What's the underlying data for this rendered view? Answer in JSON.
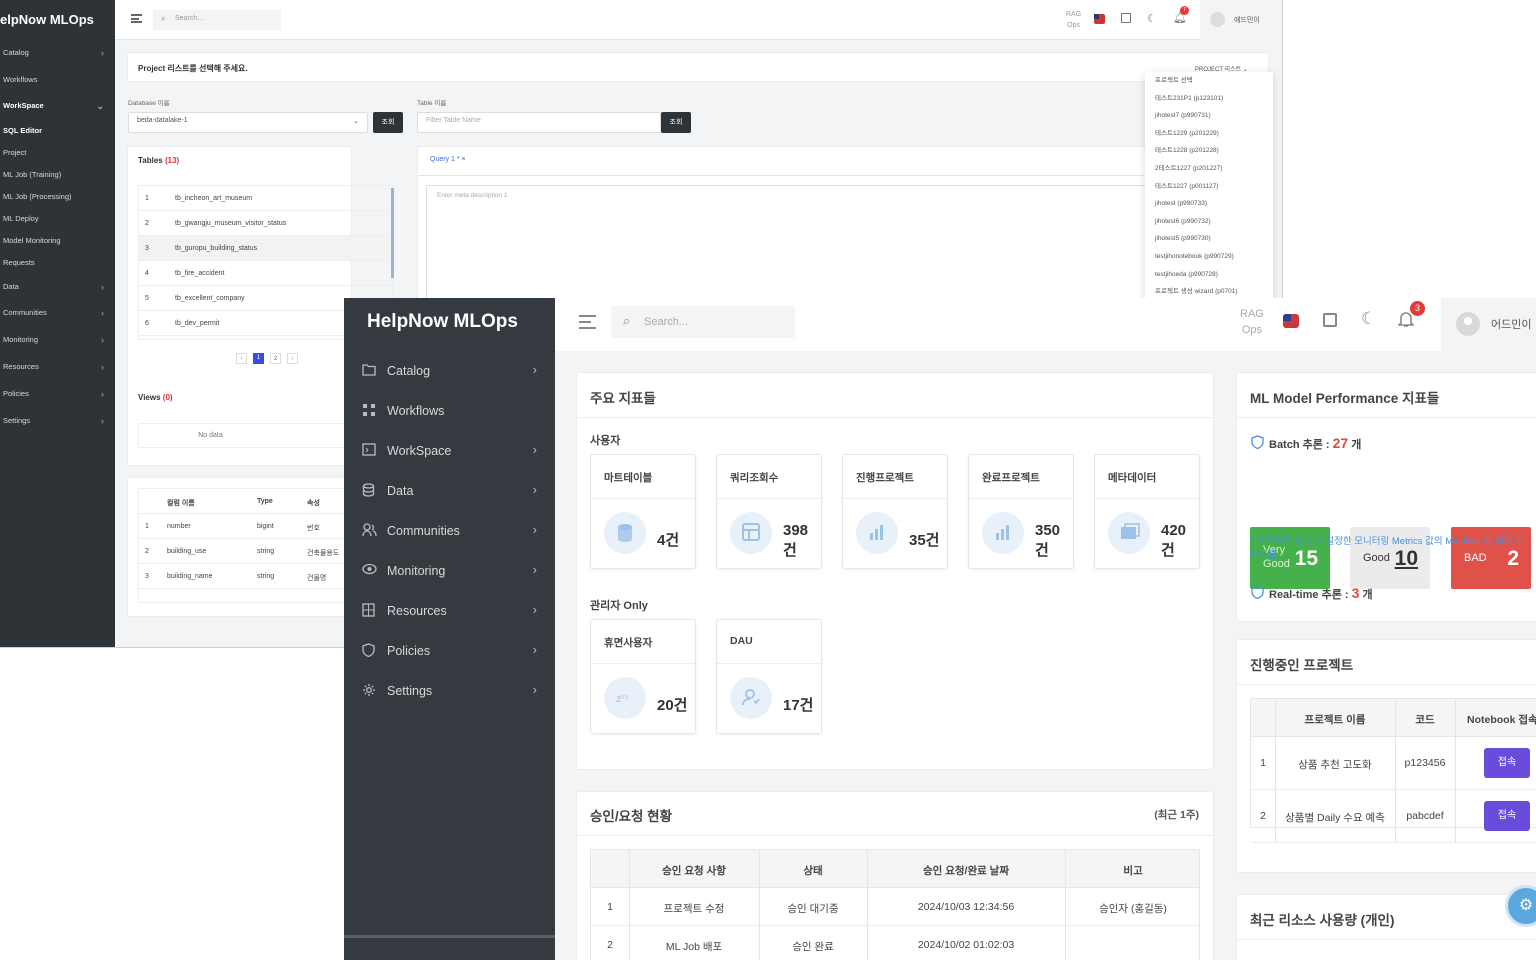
{
  "back": {
    "brand": "elpNow MLOps",
    "sidebar": [
      "Catalog",
      "Workflows",
      "WorkSpace",
      "SQL Editor",
      "Project",
      "ML Job (Training)",
      "ML Job (Processing)",
      "ML Deploy",
      "Model Monitoring",
      "Requests",
      "Data",
      "Communities",
      "Monitoring",
      "Resources",
      "Policies",
      "Settings"
    ],
    "search_placeholder": "Search...",
    "header_rag": "RAG",
    "header_ops": "Ops",
    "user": "에드민이",
    "bell_count": "7",
    "project_prompt": "Project 리스트를 선택해 주세요.",
    "project_dropdown_label": "PROJECT 리스트",
    "database_label": "Database 이름",
    "database_value": "beda-datalake-1",
    "table_label": "Table 이름",
    "table_placeholder": "Filter Table Name",
    "query_button": "조회",
    "tables_title": "Tables",
    "tables_count": "(13)",
    "tables": [
      {
        "no": "1",
        "name": "tb_incheon_art_museum"
      },
      {
        "no": "2",
        "name": "tb_gwangju_museum_visitor_status"
      },
      {
        "no": "3",
        "name": "tb_guropu_building_status"
      },
      {
        "no": "4",
        "name": "tb_fire_accident"
      },
      {
        "no": "5",
        "name": "tb_excellent_company"
      },
      {
        "no": "6",
        "name": "tb_dev_permit"
      }
    ],
    "pages": [
      "1",
      "2"
    ],
    "views_title": "Views",
    "views_count": "(0)",
    "no_data": "No data",
    "query_tab": "Query 1 *",
    "editor_placeholder": "Enter meta description 1",
    "columns_head": [
      "컬럼 이름",
      "Type",
      "속성"
    ],
    "columns": [
      {
        "no": "1",
        "name": "number",
        "type": "bigint",
        "attr": "번호"
      },
      {
        "no": "2",
        "name": "building_use",
        "type": "string",
        "attr": "건축물용도"
      },
      {
        "no": "3",
        "name": "building_name",
        "type": "string",
        "attr": "건물명"
      }
    ],
    "projects": [
      "프로젝트 선택",
      "테스트231P1 (p123101)",
      "jihotest7 (p990731)",
      "테스트1229 (p201229)",
      "테스트1228 (p201228)",
      "2테스트1227 (p201227)",
      "테스트1227 (p001127)",
      "jihotest (p990733)",
      "jihotest6 (p990732)",
      "jihotest5 (p990730)",
      "testjihonotebook (p990729)",
      "testjihoeda (p990728)",
      "프로젝트 생성 wizard (p0701)"
    ]
  },
  "front": {
    "brand": "HelpNow MLOps",
    "sidebar": [
      {
        "label": "Catalog",
        "icon": "folder-icon",
        "chev": true
      },
      {
        "label": "Workflows",
        "icon": "workflow-icon",
        "chev": false
      },
      {
        "label": "WorkSpace",
        "icon": "workspace-icon",
        "chev": true
      },
      {
        "label": "Data",
        "icon": "database-icon",
        "chev": true
      },
      {
        "label": "Communities",
        "icon": "users-icon",
        "chev": true
      },
      {
        "label": "Monitoring",
        "icon": "eye-icon",
        "chev": true
      },
      {
        "label": "Resources",
        "icon": "server-icon",
        "chev": true
      },
      {
        "label": "Policies",
        "icon": "shield-icon",
        "chev": true
      },
      {
        "label": "Settings",
        "icon": "gear-icon",
        "chev": true
      }
    ],
    "search_placeholder": "Search...",
    "header_rag": "RAG",
    "header_ops": "Ops",
    "bell_count": "3",
    "user": "어드민이",
    "kpi_title": "주요 지표들",
    "users_section": "사용자",
    "user_stats": [
      {
        "label": "마트테이블",
        "value": "4건"
      },
      {
        "label": "쿼리조회수",
        "value": "398\n건"
      },
      {
        "label": "진행프로젝트",
        "value": "35건"
      },
      {
        "label": "완료프로젝트",
        "value": "350\n건"
      },
      {
        "label": "메타데이터",
        "value": "420\n건"
      }
    ],
    "admin_section": "관리자 Only",
    "admin_stats": [
      {
        "label": "휴면사용자",
        "value": "20건"
      },
      {
        "label": "DAU",
        "value": "17건"
      }
    ],
    "approval_title": "승인/요청 현황",
    "approval_period": "(최근 1주)",
    "approval_head": [
      "승인 요청 사항",
      "상태",
      "승인 요청/완료 날짜",
      "비고"
    ],
    "approval_rows": [
      {
        "no": "1",
        "item": "프로젝트 수정",
        "status": "승인 대기중",
        "date": "2024/10/03 12:34:56",
        "note": "승인자 (홍길동)"
      },
      {
        "no": "2",
        "item": "ML Job 배포",
        "status": "승인 완료",
        "date": "2024/10/02 01:02:03",
        "note": ""
      }
    ],
    "perf_title": "ML Model Performance 지표들",
    "batch_label": "Batch 추론 :",
    "batch_count": "27",
    "batch_unit": "개",
    "perf_boxes": [
      {
        "label": "Very Good",
        "value": "15",
        "color": "#45b14a"
      },
      {
        "label": "Good",
        "value": "10",
        "color": "#ebebeb"
      },
      {
        "label": "BAD",
        "value": "2",
        "color": "#e0514a"
      }
    ],
    "perf_note": "* 프로젝트 생성 시 설정한 모니터링 Metrics 값의 Min/Max 에 의해서 표시됨",
    "realtime_label": "Real-time 추론 :",
    "realtime_count": "3",
    "realtime_unit": "개",
    "ongoing_title": "진행중인 프로젝트",
    "ongoing_head": [
      "프로젝트 이름",
      "코드",
      "Notebook 접속"
    ],
    "ongoing_rows": [
      {
        "no": "1",
        "name": "상품 추천 고도화",
        "code": "p123456",
        "btn": "접속"
      },
      {
        "no": "2",
        "name": "상품별 Daily 수요 예측",
        "code": "pabcdef",
        "btn": "접속"
      }
    ],
    "resource_title": "최근 리소스 사용량 (개인)"
  }
}
